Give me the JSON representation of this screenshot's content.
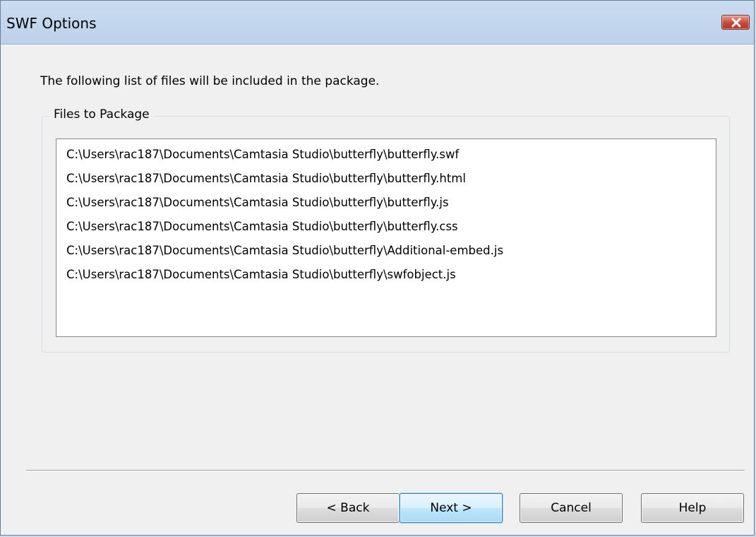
{
  "window": {
    "title": "SWF Options"
  },
  "instruction": "The following list of files will be included in the package.",
  "files_group": {
    "label": "Files to Package",
    "files": [
      "C:\\Users\\rac187\\Documents\\Camtasia Studio\\butterfly\\butterfly.swf",
      "C:\\Users\\rac187\\Documents\\Camtasia Studio\\butterfly\\butterfly.html",
      "C:\\Users\\rac187\\Documents\\Camtasia Studio\\butterfly\\butterfly.js",
      "C:\\Users\\rac187\\Documents\\Camtasia Studio\\butterfly\\butterfly.css",
      "C:\\Users\\rac187\\Documents\\Camtasia Studio\\butterfly\\Additional-embed.js",
      "C:\\Users\\rac187\\Documents\\Camtasia Studio\\butterfly\\swfobject.js"
    ]
  },
  "buttons": {
    "back": "< Back",
    "next": "Next >",
    "cancel": "Cancel",
    "help": "Help"
  },
  "colors": {
    "close_button": "#c9483a",
    "default_button_border": "#3c7fb1",
    "window_background": "#f0f0f0"
  },
  "icons": {
    "close": "close-icon"
  }
}
